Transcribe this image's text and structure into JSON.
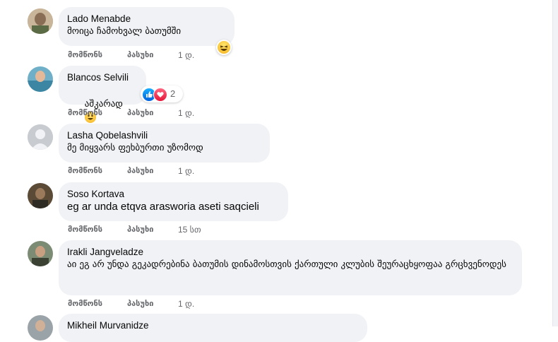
{
  "actions": {
    "like": "მომწონს",
    "reply": "პასუხი"
  },
  "comments": [
    {
      "author": "Lado Menabde",
      "text": "მოიცა ჩამოხვალ ბათუმში",
      "time": "1 დ.",
      "reaction": "laugh"
    },
    {
      "author": "Blancos Selvili",
      "text": "აშკარად",
      "time": "1 დ.",
      "reaction_count": "2"
    },
    {
      "author": "Lasha Qobelashvili",
      "text": "მე მიყვარს ფეხბურთი უზომოდ",
      "time": "1 დ."
    },
    {
      "author": "Soso Kortava",
      "text": "eg ar unda etqva arasworia aseti saqcieli",
      "time": "15 სთ"
    },
    {
      "author": "Irakli Jangveladze",
      "text": "აი ეგ არ უნდა გეკადრებინა ბათუმის დინამოსთვის ქართული კლუბის შეურაცხყოფაა გრცხვენოდეს",
      "time": "1 დ."
    },
    {
      "author": "Mikheil Murvanidze"
    }
  ],
  "colors": {
    "bubble": "#f0f2f5",
    "meta": "#65676b",
    "like_blue": "#1877f2",
    "love_red": "#f33e58"
  },
  "icons": [
    "laugh-reaction-icon",
    "like-reaction-icon",
    "love-reaction-icon",
    "smiley-emoji-icon",
    "default-avatar-icon"
  ]
}
